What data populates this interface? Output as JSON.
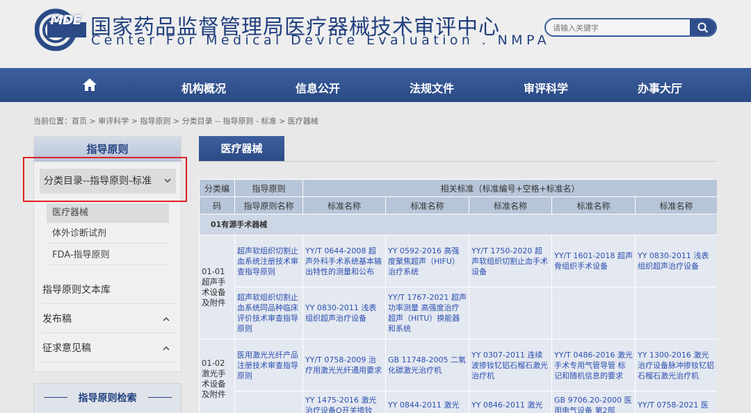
{
  "header": {
    "logo_text": "MDE",
    "title": "国家药品监督管理局医疗器械技术审评中心",
    "subtitle": "Center For Medical Device Evaluation . NMPA",
    "search_placeholder": "请输入关键字",
    "icons": {
      "search": "search-icon",
      "home": "home-icon"
    }
  },
  "nav": {
    "items": [
      "机构概况",
      "信息公开",
      "法规文件",
      "审评科学",
      "办事大厅"
    ]
  },
  "breadcrumb": "当前位置：首页 > 审评科学 > 指导原则 > 分类目录 -- 指导原则 - 标准 > 医疗器械",
  "sidebar": {
    "header": "指导原则",
    "active": "分类目录--指导原则-标准",
    "sub_items": [
      "医疗器械",
      "体外诊断试剂",
      "FDA-指导原则"
    ],
    "items": [
      "指导原则文本库",
      "发布稿",
      "征求意见稿"
    ],
    "search_title": "指导原则检索"
  },
  "main": {
    "tab": "医疗器械",
    "table": {
      "head1": [
        "分类编",
        "指导原则",
        "相关标准（标准编号+空格+标准名）"
      ],
      "head2": [
        "码",
        "指导原则名称",
        "标准名称",
        "标准名称",
        "标准名称",
        "标准名称",
        "标准名称"
      ],
      "group": "01有源手术器械",
      "rows": [
        {
          "category": "01-01超声手术设备及附件",
          "entries": [
            {
              "guide": "超声软组织切割止血系统注册技术审查指导原则",
              "standards": [
                "YY/T 0644-2008 超声外科手术系统基本输出特性的测量和公布",
                "YY 0592-2016 高强度聚焦超声（HIFU）治疗系统",
                "YY/T 1750-2020 超声软组织切割止血手术设备",
                "YY/T 1601-2018 超声骨组织手术设备",
                "YY 0830-2011 浅表组织超声治疗设备"
              ]
            },
            {
              "guide": "超声软组织切割止血系统同品种临床评价技术审查指导原则",
              "standards": [
                "YY 0830-2011 浅表组织超声治疗设备",
                "YY/T 1767-2021 超声 功率测量 高强度治疗超声（HITU）换能器和系统",
                "",
                "",
                ""
              ]
            }
          ]
        },
        {
          "category": "01-02激光手术设备及附件",
          "entries": [
            {
              "guide": "医用激光光纤产品注册技术审查指导原则",
              "standards": [
                "YY/T 0758-2009 治疗用激光光纤通用要求",
                "GB 11748-2005 二氧化碳激光治疗机",
                "YY 0307-2011 连续波掺钕钇铝石榴石激光治疗机",
                "YY/T 0486-2016 激光手术专用气管导管 标记和随机信息的要求",
                "YY 1300-2016 激光治疗设备脉冲掺钕钇铝石榴石激光治疗机"
              ]
            },
            {
              "guide": "",
              "standards": [
                "YY 1475-2016 激光治疗设备Q开关掺钕",
                "YY 0844-2011 激光",
                "YY 0846-2011 激光",
                "GB 9706.20-2000 医用电气设备 第2部",
                "YY/T 0758-2021 医"
              ]
            }
          ]
        }
      ]
    }
  },
  "colors": {
    "brand": "#22407f",
    "nav": "#2b4a85",
    "highlight": "#e02020",
    "link": "#2a4fb0"
  }
}
